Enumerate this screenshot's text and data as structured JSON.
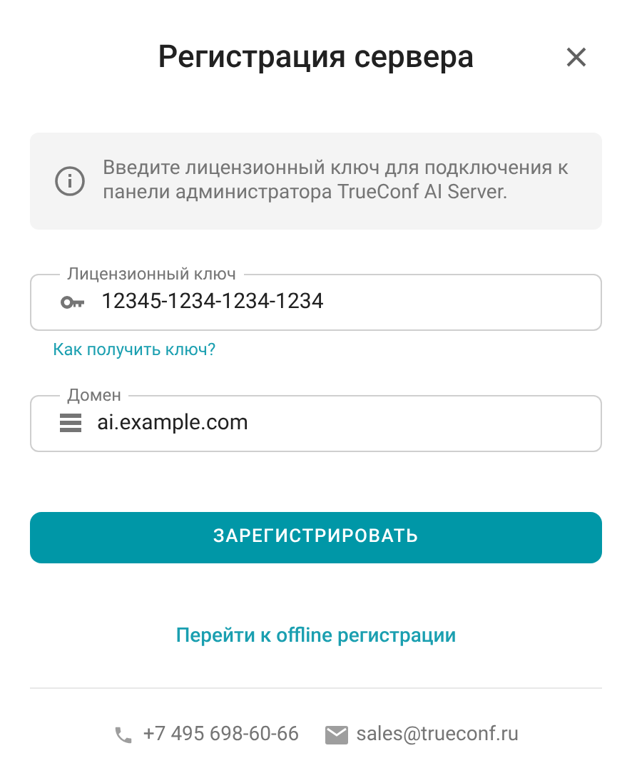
{
  "dialog": {
    "title": "Регистрация сервера"
  },
  "info": {
    "text": "Введите лицензионный ключ для подключения к панели администратора TrueConf AI Server."
  },
  "fields": [
    {
      "kind": "key",
      "label": "Лицензионный ключ",
      "value": "12345-1234-1234-1234",
      "help_link": "Как получить ключ?"
    },
    {
      "kind": "server",
      "label": "Домен",
      "value": "ai.example.com"
    }
  ],
  "primary_button": "ЗАРЕГИСТРИРОВАТЬ",
  "offline_link": "Перейти к offline регистрации",
  "contacts": [
    {
      "kind": "phone",
      "text": "+7 495 698-60-66"
    },
    {
      "kind": "email",
      "text": "sales@trueconf.ru"
    }
  ]
}
